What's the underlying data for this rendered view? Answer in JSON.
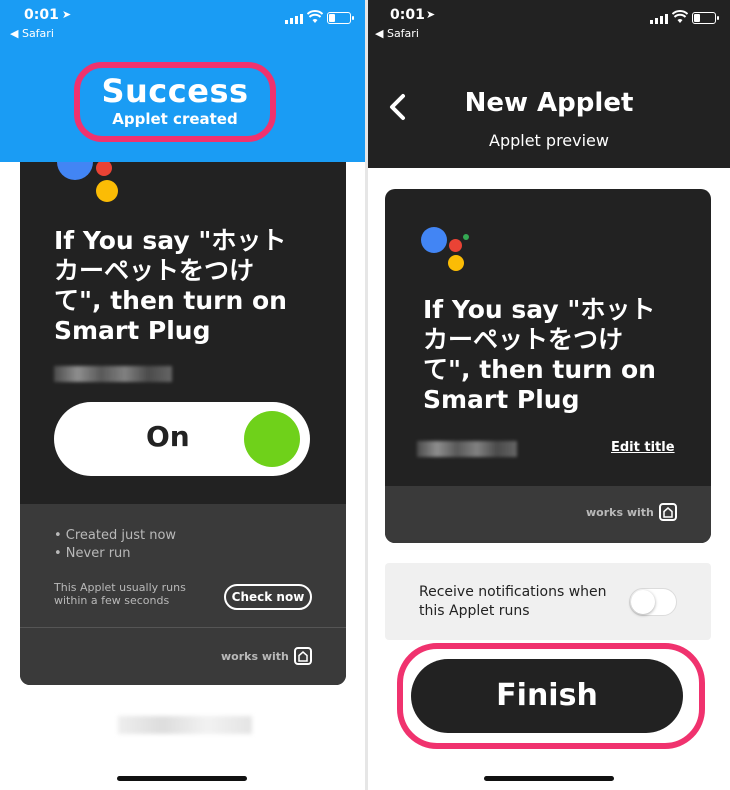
{
  "status_bar": {
    "time": "0:01",
    "back_app": "◀ Safari"
  },
  "left": {
    "banner": {
      "title": "Success",
      "subtitle": "Applet created"
    },
    "applet_title_lines": [
      "If You say \"ホット",
      "カーペットをつけ",
      "て\", then turn on",
      "Smart Plug"
    ],
    "toggle_label": "On",
    "meta": [
      "• Created just now",
      "• Never run"
    ],
    "usually_text": "This Applet usually runs within a few seconds",
    "check_button": "Check now",
    "works_with": "works with"
  },
  "right": {
    "nav": {
      "title": "New Applet",
      "subtitle": "Applet preview"
    },
    "applet_title_lines": [
      "If You say \"ホット",
      "カーペットをつけ",
      "て\", then turn on",
      "Smart Plug"
    ],
    "edit_title": "Edit title",
    "works_with": "works with",
    "notification_text": "Receive notifications when this Applet runs",
    "notification_enabled": false,
    "finish_button": "Finish"
  },
  "colors": {
    "success_banner": "#1a9cf4",
    "highlight": "#f0326e",
    "card": "#222222",
    "toggle_on": "#6fd11a",
    "assistant_blue": "#4285f4",
    "assistant_red": "#ea4335",
    "assistant_yellow": "#fbbc05",
    "assistant_green": "#34a853"
  }
}
